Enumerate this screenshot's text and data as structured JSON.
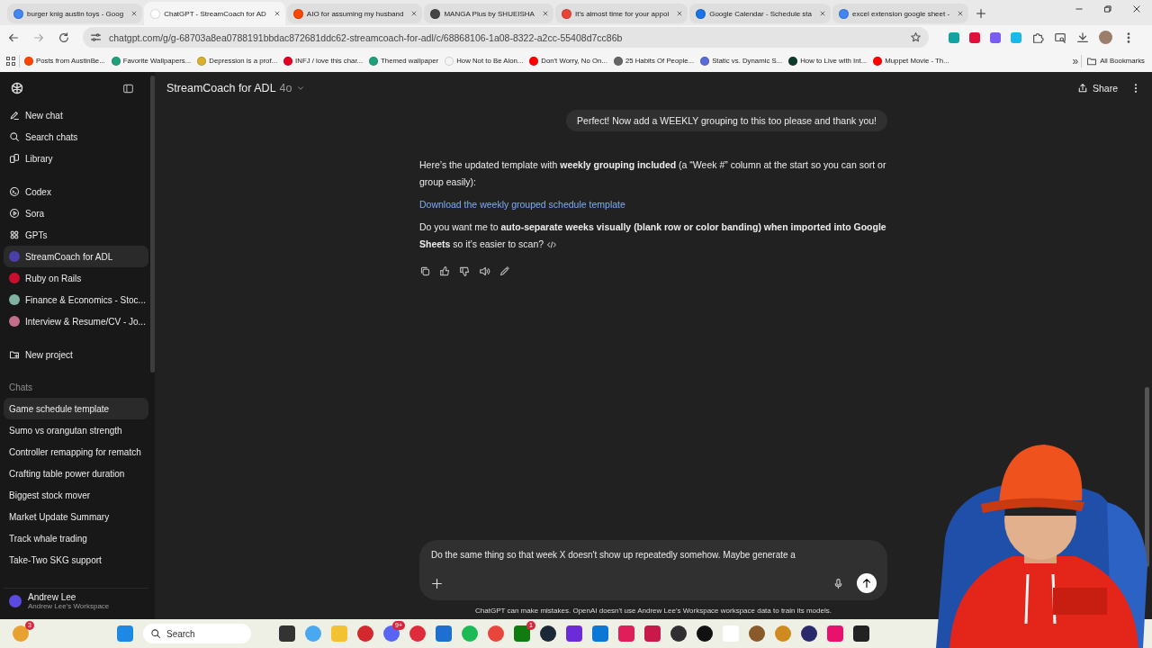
{
  "browser": {
    "tabs": [
      {
        "title": "burger knig austin toys - Goog",
        "kind": "google",
        "selected": false
      },
      {
        "title": "ChatGPT - StreamCoach for AD",
        "kind": "chatgpt",
        "selected": true
      },
      {
        "title": "AIO for assuming my husband",
        "kind": "reddit",
        "selected": false
      },
      {
        "title": "MANGA Plus by SHUEISHA",
        "kind": "manga",
        "selected": false
      },
      {
        "title": "It's almost time for your appoi",
        "kind": "gmail",
        "selected": false
      },
      {
        "title": "Google Calendar - Schedule sta",
        "kind": "calendar",
        "selected": false
      },
      {
        "title": "excel extension google sheet -",
        "kind": "google",
        "selected": false
      }
    ],
    "address": "chatgpt.com/g/g-68703a8ea0788191bbdac872681ddc62-streamcoach-for-adl/c/68868106-1a08-8322-a2cc-55408d7cc86b",
    "bookmarks": [
      {
        "label": "Posts from AustinBe...",
        "kind": "reddit"
      },
      {
        "label": "Favorite Wallpapers...",
        "kind": "wallpaper"
      },
      {
        "label": "Depression is a prof...",
        "kind": "emoji"
      },
      {
        "label": "INFJ / love this char...",
        "kind": "pinterest"
      },
      {
        "label": "Themed wallpaper",
        "kind": "wallpaper"
      },
      {
        "label": "How Not to Be Alon...",
        "kind": "page"
      },
      {
        "label": "Don't Worry, No On...",
        "kind": "youtube"
      },
      {
        "label": "25 Habits Of People...",
        "kind": "waves"
      },
      {
        "label": "Static vs. Dynamic S...",
        "kind": "wordpress"
      },
      {
        "label": "How to Live with Int...",
        "kind": "bolt"
      },
      {
        "label": "Muppet Movie - Th...",
        "kind": "youtube"
      }
    ],
    "more": "»",
    "all_bookmarks": "All Bookmarks"
  },
  "sidebar": {
    "nav": [
      {
        "label": "New chat",
        "kind": "pencil",
        "selected": false
      },
      {
        "label": "Search chats",
        "kind": "search",
        "selected": false
      },
      {
        "label": "Library",
        "kind": "library",
        "selected": false
      }
    ],
    "gpts": [
      {
        "label": "Codex",
        "kind": "codex",
        "selected": false
      },
      {
        "label": "Sora",
        "kind": "sora",
        "selected": false
      },
      {
        "label": "GPTs",
        "kind": "gpts",
        "selected": false
      },
      {
        "label": "StreamCoach for ADL",
        "kind": "avatar",
        "color": "#4a3fa8",
        "selected": true
      },
      {
        "label": "Ruby on Rails",
        "kind": "avatar",
        "color": "#c8102e",
        "selected": false
      },
      {
        "label": "Finance & Economics - Stoc...",
        "kind": "avatar",
        "color": "#7fb3a0",
        "selected": false
      },
      {
        "label": "Interview & Resume/CV - Jo...",
        "kind": "avatar",
        "color": "#c0708a",
        "selected": false
      }
    ],
    "project": {
      "label": "New project",
      "kind": "folder_plus",
      "selected": false
    },
    "chats_heading": "Chats",
    "chats": [
      {
        "label": "Game schedule template",
        "selected": true
      },
      {
        "label": "Sumo vs orangutan strength",
        "selected": false
      },
      {
        "label": "Controller remapping for rematch",
        "selected": false
      },
      {
        "label": "Crafting table power duration",
        "selected": false
      },
      {
        "label": "Biggest stock mover",
        "selected": false
      },
      {
        "label": "Market Update Summary",
        "selected": false
      },
      {
        "label": "Track whale trading",
        "selected": false
      },
      {
        "label": "Take-Two SKG support",
        "selected": false
      }
    ],
    "user": {
      "name": "Andrew Lee",
      "workspace": "Andrew Lee's Workspace"
    }
  },
  "header": {
    "title": "StreamCoach for ADL",
    "model": "4o",
    "share": "Share"
  },
  "messages": [
    {
      "kind": "user",
      "text": "Perfect! Now add a WEEKLY grouping to this too please and thank you!"
    },
    {
      "kind": "assistant",
      "blocks": [
        {
          "kind": "paragraph",
          "text": "Here’s the updated template with **weekly grouping included** (a “Week #” column at the start so you can sort or group easily):",
          "code_badge": false
        },
        {
          "kind": "link",
          "text": "Download the weekly grouped schedule template"
        },
        {
          "kind": "paragraph",
          "text": "Do you want me to **auto-separate weeks visually (blank row or color banding) when imported into Google Sheets** so it’s easier to scan?",
          "code_badge": true
        }
      ]
    }
  ],
  "composer": {
    "value": "Do the same thing so that week X doesn't show up repeatedly somehow. Maybe generate a",
    "disclaimer": "ChatGPT can make mistakes. OpenAI doesn't use Andrew Lee's Workspace workspace data to train its models."
  },
  "taskbar": {
    "search_placeholder": "Search",
    "left": [
      {
        "kind": "weather",
        "badge": "3"
      },
      {
        "kind": "windows"
      }
    ],
    "apps": [
      {
        "kind": "taskview"
      },
      {
        "kind": "copilot"
      },
      {
        "kind": "folder"
      },
      {
        "kind": "bird"
      },
      {
        "kind": "discord",
        "badge": "9+"
      },
      {
        "kind": "record"
      },
      {
        "kind": "store"
      },
      {
        "kind": "spotify"
      },
      {
        "kind": "chrome"
      },
      {
        "kind": "xbox",
        "badge": "1"
      },
      {
        "kind": "steam"
      },
      {
        "kind": "purple"
      },
      {
        "kind": "vscode"
      },
      {
        "kind": "slack"
      },
      {
        "kind": "rider"
      },
      {
        "kind": "obs"
      },
      {
        "kind": "note"
      },
      {
        "kind": "file"
      },
      {
        "kind": "shield"
      },
      {
        "kind": "amber"
      },
      {
        "kind": "disc"
      },
      {
        "kind": "pink"
      },
      {
        "kind": "yellow"
      }
    ]
  }
}
